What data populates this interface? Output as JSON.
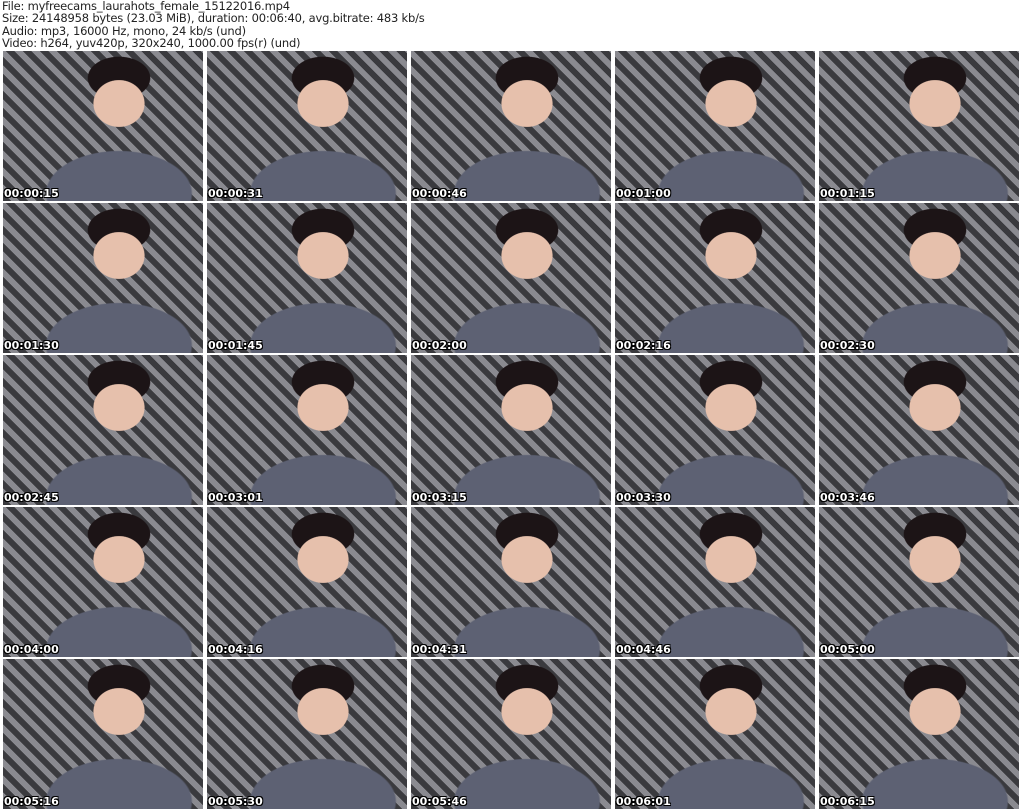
{
  "header": {
    "file": "File: myfreecams_laurahots_female_15122016.mp4",
    "size": "Size: 24148958 bytes (23.03 MiB), duration: 00:06:40, avg.bitrate: 483 kb/s",
    "audio": "Audio: mp3, 16000 Hz, mono, 24 kb/s (und)",
    "video": "Video: h264, yuv420p, 320x240, 1000.00 fps(r) (und)"
  },
  "thumbnails": [
    "00:00:15",
    "00:00:31",
    "00:00:46",
    "00:01:00",
    "00:01:15",
    "00:01:30",
    "00:01:45",
    "00:02:00",
    "00:02:16",
    "00:02:30",
    "00:02:45",
    "00:03:01",
    "00:03:15",
    "00:03:30",
    "00:03:46",
    "00:04:00",
    "00:04:16",
    "00:04:31",
    "00:04:46",
    "00:05:00",
    "00:05:16",
    "00:05:30",
    "00:05:46",
    "00:06:01",
    "00:06:15"
  ]
}
